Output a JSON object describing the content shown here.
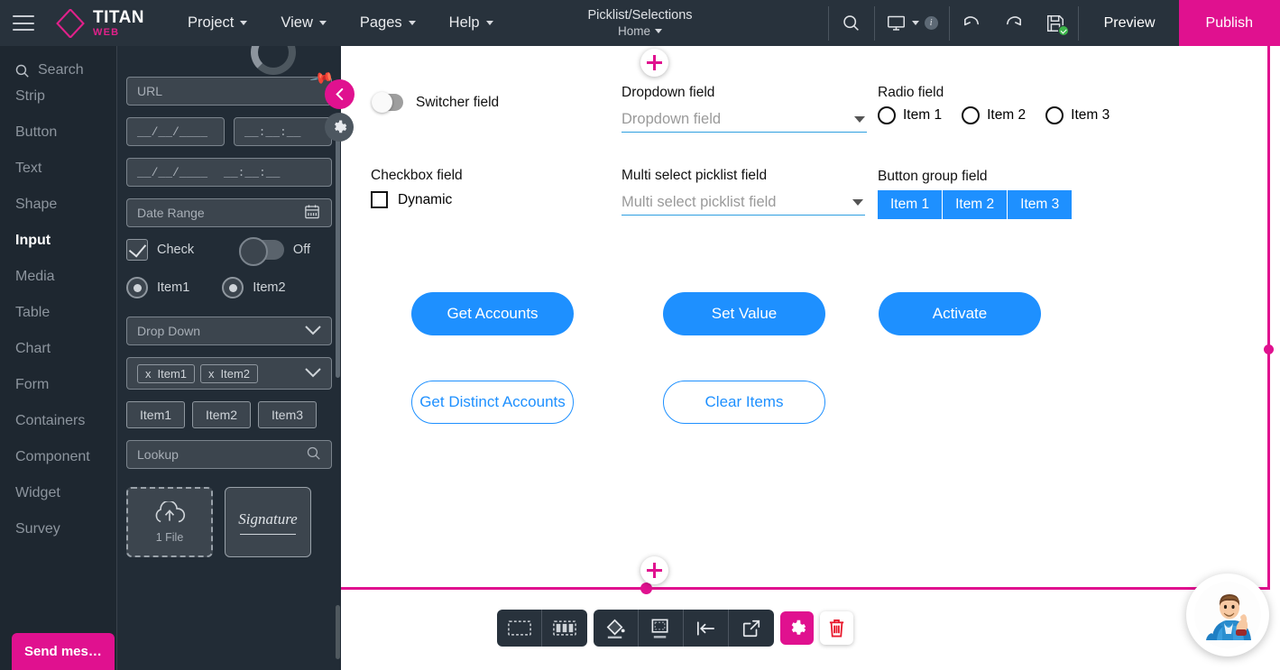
{
  "topbar": {
    "brand_title": "TITAN",
    "brand_sub": "WEB",
    "menus": [
      "Project",
      "View",
      "Pages",
      "Help"
    ],
    "page_title": "Picklist/Selections",
    "page_sub": "Home",
    "preview_label": "Preview",
    "publish_label": "Publish",
    "accent_magenta": "#e0118f",
    "bar_bg": "#28323c"
  },
  "sidebar": {
    "search_label": "Search",
    "items": [
      {
        "label": "Strip",
        "active": false
      },
      {
        "label": "Button",
        "active": false
      },
      {
        "label": "Text",
        "active": false
      },
      {
        "label": "Shape",
        "active": false
      },
      {
        "label": "Input",
        "active": true
      },
      {
        "label": "Media",
        "active": false
      },
      {
        "label": "Table",
        "active": false
      },
      {
        "label": "Chart",
        "active": false
      },
      {
        "label": "Form",
        "active": false
      },
      {
        "label": "Containers",
        "active": false
      },
      {
        "label": "Component",
        "active": false
      },
      {
        "label": "Widget",
        "active": false
      },
      {
        "label": "Survey",
        "active": false
      }
    ],
    "send_message_label": "Send mes…"
  },
  "panel": {
    "url_field": "URL",
    "date_mask": "__/__/____",
    "time_mask": "__:__:__",
    "datetime_date": "__/__/____",
    "datetime_time": "__:__:__",
    "date_range": "Date Range",
    "check_label": "Check",
    "toggle_label": "Off",
    "radio1": "Item1",
    "radio2": "Item2",
    "dropdown": "Drop Down",
    "chip1": "Item1",
    "chip2": "Item2",
    "chip_x": "x",
    "gbtn1": "Item1",
    "gbtn2": "Item2",
    "gbtn3": "Item3",
    "lookup": "Lookup",
    "upload_label": "1 File",
    "signature_label": "Signature"
  },
  "canvas": {
    "switcher_label": "Switcher field",
    "dropdown_label": "Dropdown field",
    "dropdown_placeholder": "Dropdown field",
    "radio_label": "Radio field",
    "radio_items": [
      "Item 1",
      "Item 2",
      "Item 3"
    ],
    "checkbox_label": "Checkbox field",
    "checkbox_item": "Dynamic",
    "multiselect_label": "Multi select picklist field",
    "multiselect_placeholder": "Multi select picklist field",
    "buttongroup_label": "Button group field",
    "buttongroup_items": [
      "Item 1",
      "Item 2",
      "Item 3"
    ],
    "buttons_filled": [
      "Get Accounts",
      "Set Value",
      "Activate"
    ],
    "buttons_outline": [
      "Get Distinct Accounts",
      "Clear Items"
    ],
    "accent_blue": "#1e90ff"
  }
}
